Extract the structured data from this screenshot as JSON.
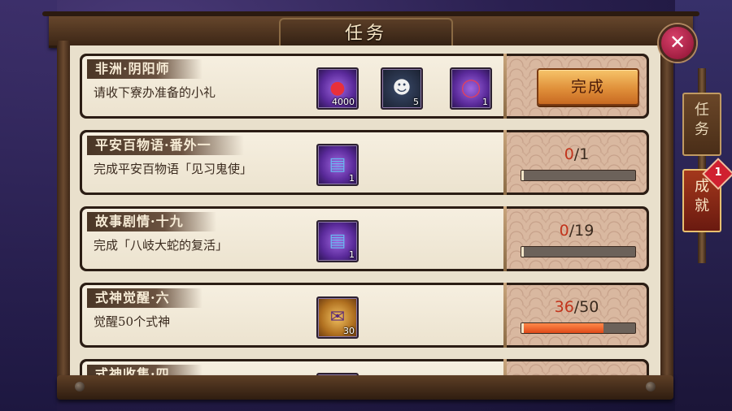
{
  "header": {
    "title": "任务"
  },
  "side_tabs": [
    {
      "label_line1": "任",
      "label_line2": "务",
      "active": false
    },
    {
      "label_line1": "成",
      "label_line2": "就",
      "active": true,
      "badge": "1"
    }
  ],
  "quests": [
    {
      "title": "非洲·阴阳师",
      "description": "请收下寮办准备的小礼",
      "rewards": [
        {
          "icon": "red-daruma-icon",
          "qty": "4000"
        },
        {
          "icon": "black-daruma-icon",
          "qty": "5"
        },
        {
          "icon": "magatama-bracelet-icon",
          "qty": "1"
        }
      ],
      "action": {
        "type": "button",
        "label": "完成"
      }
    },
    {
      "title": "平安百物语·番外一",
      "description": "完成平安百物语「见习鬼使」",
      "rewards": [
        {
          "icon": "blue-talisman-icon",
          "qty": "1"
        }
      ],
      "action": {
        "type": "progress",
        "current": "0",
        "total": "/1",
        "fraction": 0
      }
    },
    {
      "title": "故事剧情·十九",
      "description": "完成「八岐大蛇的复活」",
      "rewards": [
        {
          "icon": "blue-talisman-icon",
          "qty": "1"
        }
      ],
      "action": {
        "type": "progress",
        "current": "0",
        "total": "/19",
        "fraction": 0
      }
    },
    {
      "title": "式神觉醒·六",
      "description": "觉醒50个式神",
      "rewards": [
        {
          "icon": "seal-scroll-icon",
          "qty": "30"
        }
      ],
      "action": {
        "type": "progress",
        "current": "36",
        "total": "/50",
        "fraction": 0.72
      }
    },
    {
      "title": "式神收集·四",
      "description": "",
      "rewards": [
        {
          "icon": "blue-talisman-icon",
          "qty": ""
        }
      ],
      "action": {
        "type": "progress",
        "current": "",
        "total": "",
        "fraction": 0
      }
    }
  ],
  "colors": {
    "progress_current": "#c2341c",
    "button": "#e0903a",
    "active_tab": "#a4381c"
  }
}
